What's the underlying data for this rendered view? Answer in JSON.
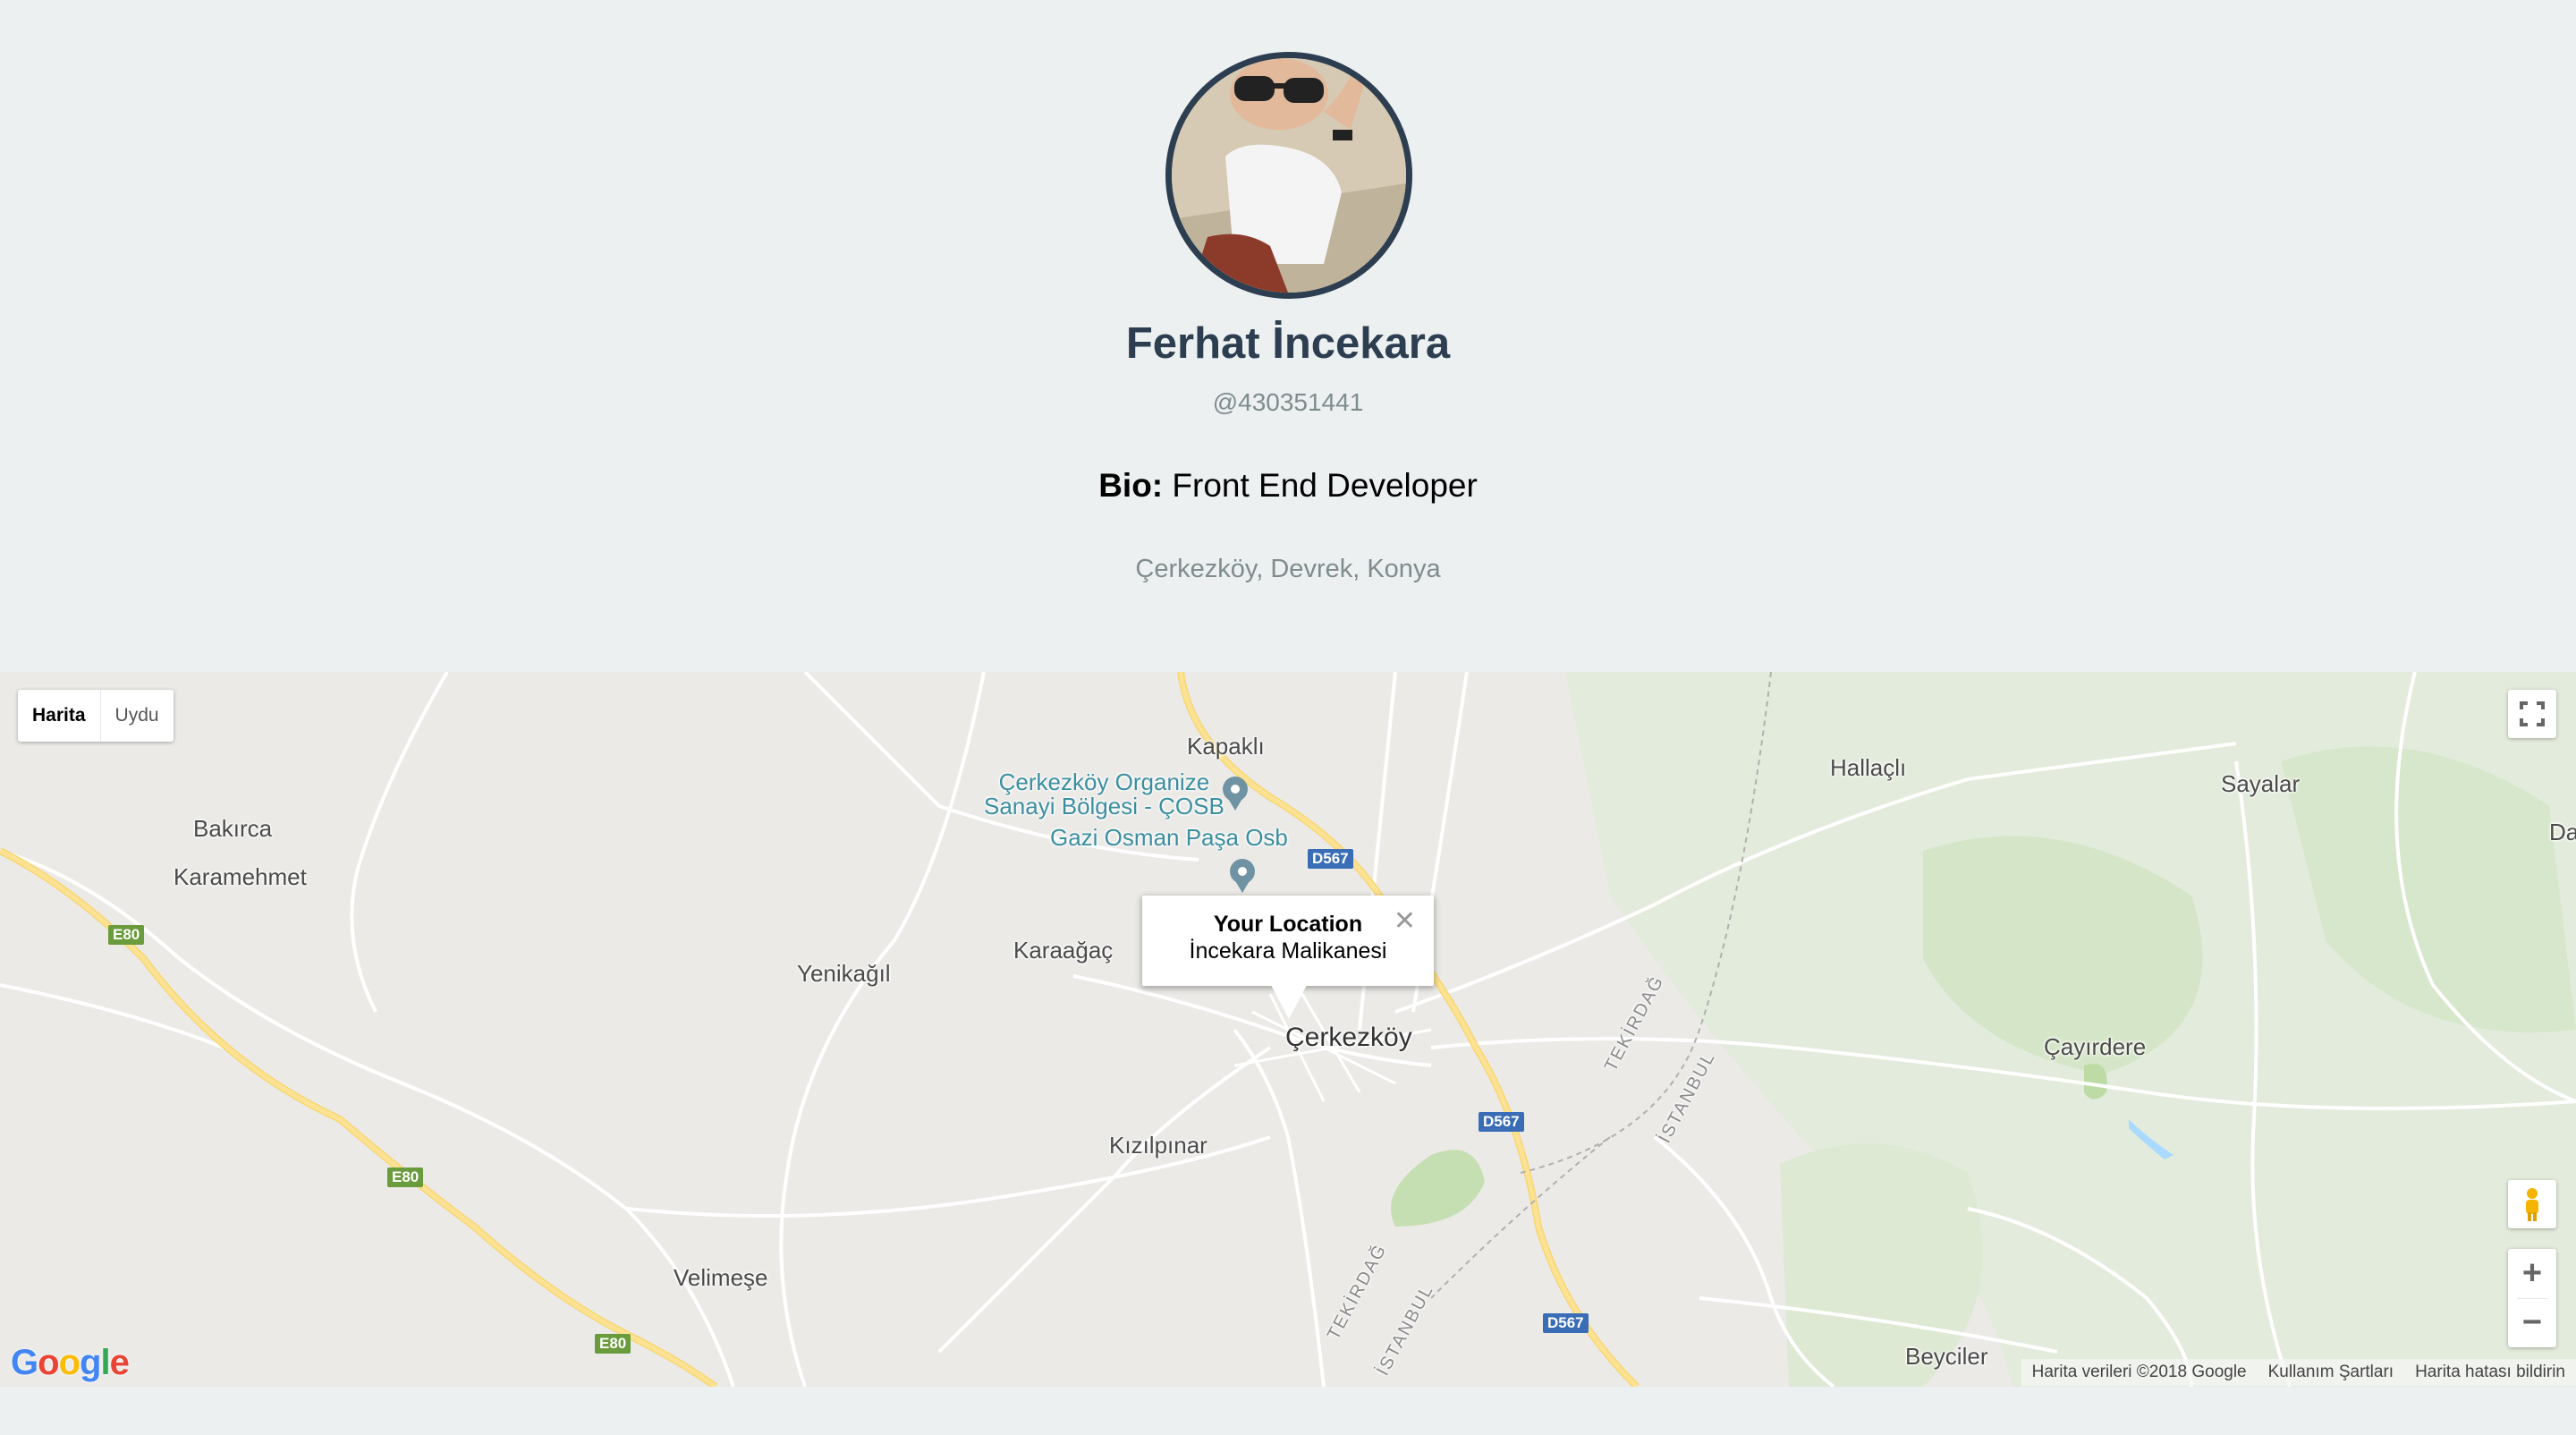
{
  "profile": {
    "name": "Ferhat İncekara",
    "handle": "@430351441",
    "bio_label": "Bio:",
    "bio_text": "Front End Developer",
    "location": "Çerkezköy, Devrek, Konya"
  },
  "map": {
    "type_buttons": {
      "map": "Harita",
      "satellite": "Uydu"
    },
    "infowindow": {
      "title": "Your Location",
      "subtitle": "İncekara Malikanesi",
      "close": "✕"
    },
    "labels": {
      "kapakli": "Kapaklı",
      "osb1": "Çerkezköy Organize",
      "osb2": "Sanayi Bölgesi - ÇOSB",
      "gazi": "Gazi Osman Paşa Osb",
      "bakirca": "Bakırca",
      "karamehmet": "Karamehmet",
      "yenikagil": "Yenikağıl",
      "karaagac": "Karaağaç",
      "cerkezkoy": "Çerkezköy",
      "kizilpinar": "Kızılpınar",
      "velimese": "Velimeşe",
      "hallacli": "Hallaçlı",
      "sayalar": "Sayalar",
      "da": "Da",
      "cayirdere": "Çayırdere",
      "beyciler": "Beyciler",
      "tekirdag1": "TEKİRDAĞ",
      "istanbul1": "İSTANBUL",
      "tekirdag2": "TEKİRDAĞ",
      "istanbul2": "İSTANBUL"
    },
    "shields": {
      "e80a": "E80",
      "e80b": "E80",
      "e80c": "E80",
      "d567a": "D567",
      "d567b": "D567",
      "d567c": "D567"
    },
    "attribution": {
      "data": "Harita verileri ©2018 Google",
      "terms": "Kullanım Şartları",
      "report": "Harita hatası bildirin"
    },
    "logo": "Google"
  }
}
